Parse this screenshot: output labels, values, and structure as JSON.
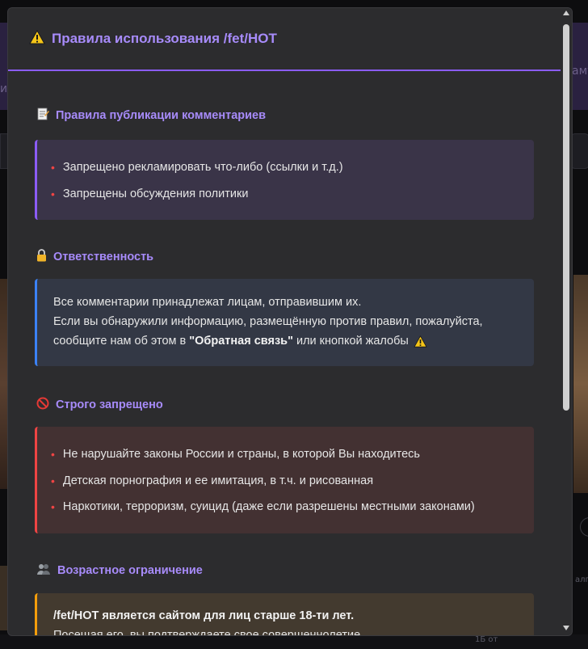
{
  "background": {
    "left_fragment": "и",
    "right_fragment": "аму",
    "small_right": "алго",
    "small_bottom": "1Б от"
  },
  "modal": {
    "title_icon": "warning-icon",
    "title": "Правила использования /fet/HOT",
    "accent_color": "#8b5cf6",
    "sections": [
      {
        "icon": "memo-icon",
        "title": "Правила публикации комментариев",
        "items": [
          "Запрещено рекламировать что-либо (ссылки и т.д.)",
          "Запрещены обсуждения политики"
        ]
      },
      {
        "icon": "lock-icon",
        "title": "Ответственность",
        "line1": "Все комментарии принадлежат лицам, отправившим их.",
        "line2": "Если вы обнаружили информацию, размещённую против правил, пожалуйста,",
        "line3_pre": "сообщите нам об этом в ",
        "line3_bold": "\"Обратная связь\"",
        "line3_post": " или кнопкой жалобы"
      },
      {
        "icon": "prohibited-icon",
        "title": "Строго запрещено",
        "items": [
          "Не нарушайте законы России и страны, в которой Вы находитесь",
          "Детская порнография и ее имитация, в т.ч. и рисованная",
          "Наркотики, терроризм, суицид (даже если разрешены местными законами)"
        ]
      },
      {
        "icon": "people-icon",
        "title": "Возрастное ограничение",
        "line1_bold": "/fet/HOT является сайтом для лиц старше 18-ти лет.",
        "line2": "Посещая его, вы подтверждаете свое совершеннолетие."
      }
    ]
  }
}
